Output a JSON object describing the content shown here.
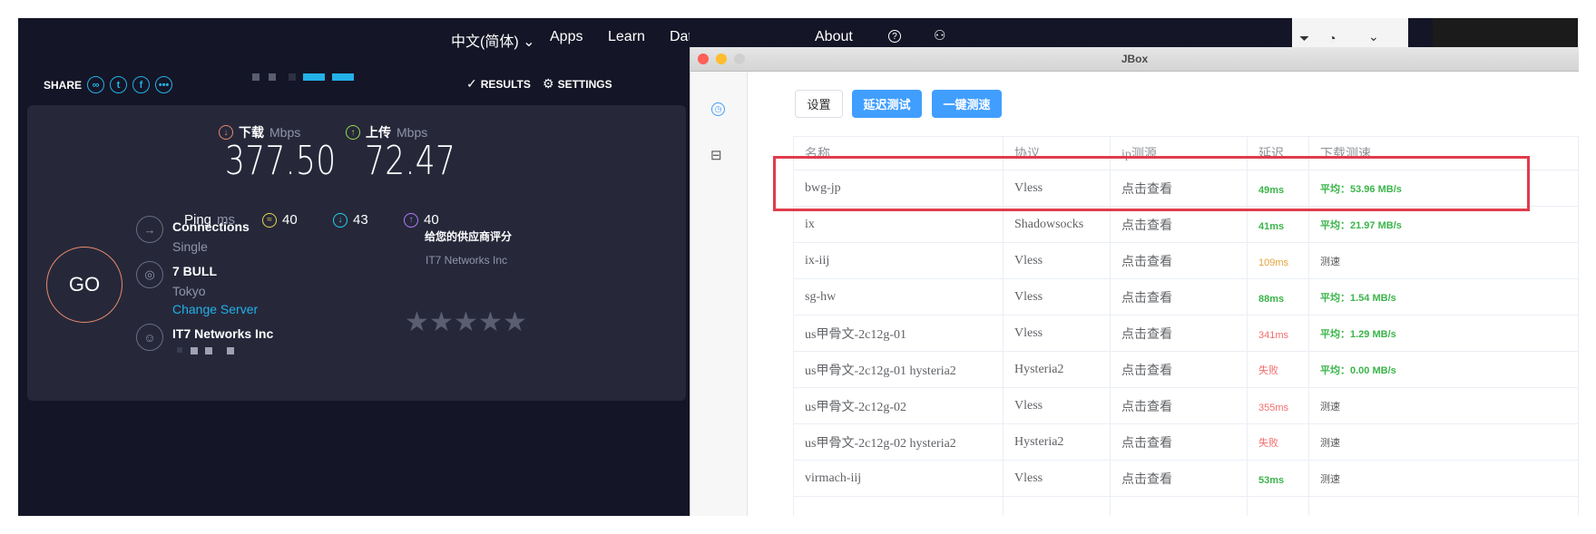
{
  "speedtest": {
    "nav": {
      "language": "中文(简体)",
      "apps": "Apps",
      "learn": "Learn",
      "data": "Data",
      "about": "About"
    },
    "share_label": "SHARE",
    "results_label": "RESULTS",
    "settings_label": "SETTINGS",
    "download": {
      "label": "下载",
      "unit": "Mbps",
      "value": "377.50"
    },
    "upload": {
      "label": "上传",
      "unit": "Mbps",
      "value": "72.47"
    },
    "ping": {
      "label": "Ping",
      "unit": "ms",
      "idle": "40",
      "download": "43",
      "upload": "40"
    },
    "go_label": "GO",
    "connections": {
      "title": "Connections",
      "value": "Single"
    },
    "server": {
      "name": "7 BULL",
      "city": "Tokyo",
      "change": "Change Server"
    },
    "provider": {
      "name": "IT7 Networks Inc"
    },
    "rating": {
      "title": "给您的供应商评分",
      "provider": "IT7 Networks Inc",
      "stars": 5
    }
  },
  "jbox": {
    "window_title": "JBox",
    "buttons": {
      "settings": "设置",
      "latency_test": "延迟测试",
      "speed_test": "一键测速"
    },
    "columns": [
      "名称",
      "协议",
      "ip测源",
      "延迟",
      "下载测速"
    ],
    "rows": [
      {
        "name": "bwg-jp",
        "protocol": "Vless",
        "ip": "点击查看",
        "latency": "49ms",
        "speed": "平均：53.96 MB/s"
      },
      {
        "name": "ix",
        "protocol": "Shadowsocks",
        "ip": "点击查看",
        "latency": "41ms",
        "speed": "平均：21.97 MB/s"
      },
      {
        "name": "ix-iij",
        "protocol": "Vless",
        "ip": "点击查看",
        "latency": "109ms",
        "speed": "测速"
      },
      {
        "name": "sg-hw",
        "protocol": "Vless",
        "ip": "点击查看",
        "latency": "88ms",
        "speed": "平均：1.54 MB/s"
      },
      {
        "name": "us甲骨文-2c12g-01",
        "protocol": "Vless",
        "ip": "点击查看",
        "latency": "341ms",
        "speed": "平均：1.29 MB/s"
      },
      {
        "name": "us甲骨文-2c12g-01 hysteria2",
        "protocol": "Hysteria2",
        "ip": "点击查看",
        "latency": "失败",
        "speed": "平均：0.00 MB/s"
      },
      {
        "name": "us甲骨文-2c12g-02",
        "protocol": "Vless",
        "ip": "点击查看",
        "latency": "355ms",
        "speed": "测速"
      },
      {
        "name": "us甲骨文-2c12g-02 hysteria2",
        "protocol": "Hysteria2",
        "ip": "点击查看",
        "latency": "失败",
        "speed": "测速"
      },
      {
        "name": "virmach-iij",
        "protocol": "Vless",
        "ip": "点击查看",
        "latency": "53ms",
        "speed": "测速"
      }
    ],
    "colors": {
      "accent": "#409eff",
      "ok": "#3bb54a",
      "warn": "#e6a23c",
      "fail": "#f56c6c",
      "highlight": "#e03c4b"
    }
  }
}
